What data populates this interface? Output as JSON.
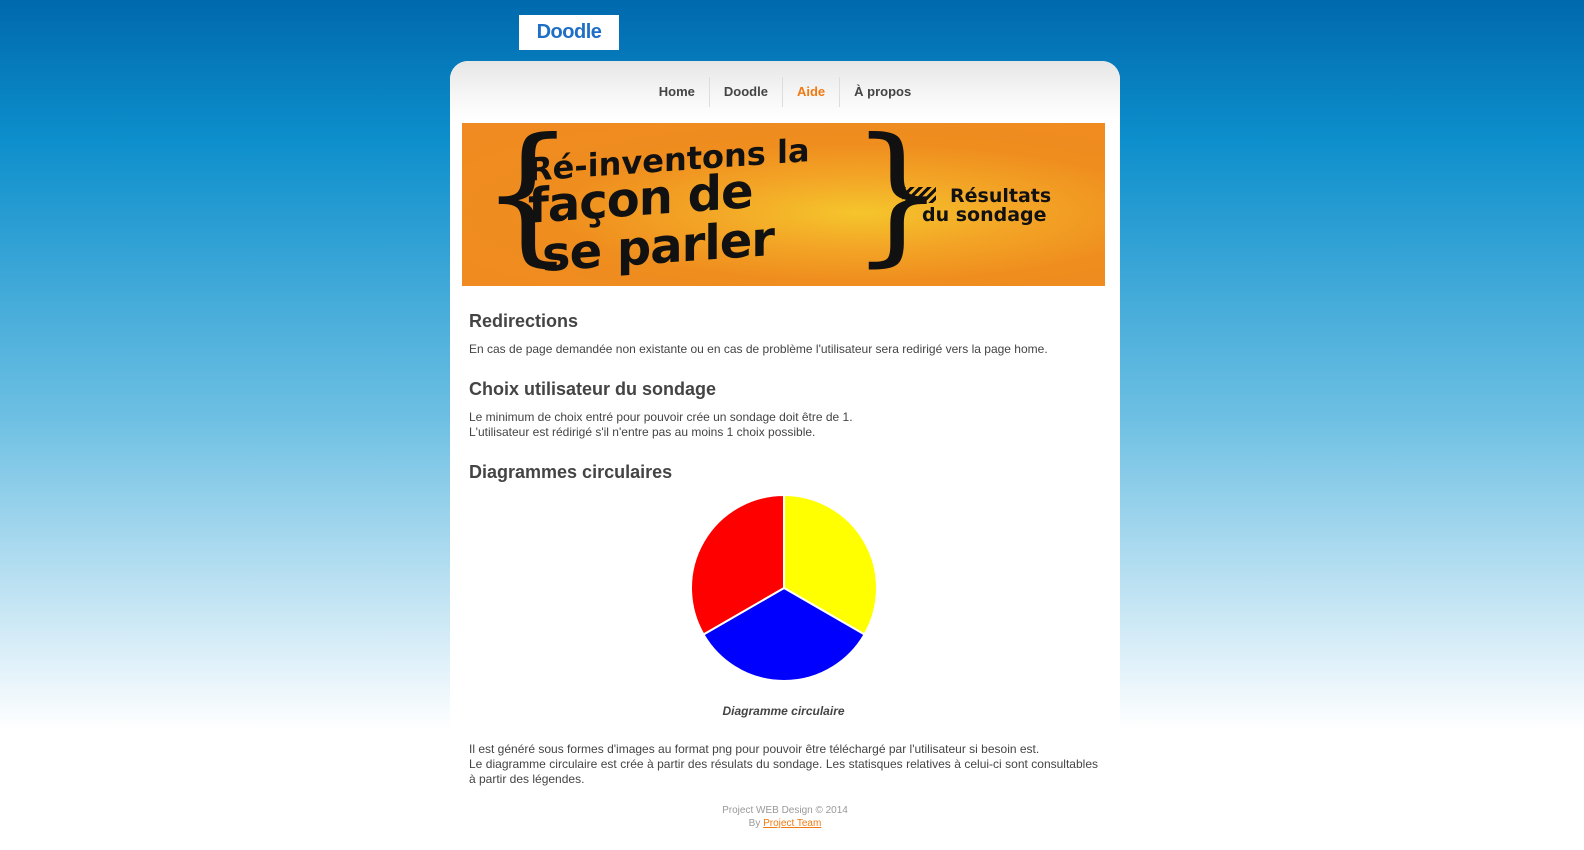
{
  "logo": {
    "text": "Doodle"
  },
  "nav": {
    "items": [
      {
        "label": "Home"
      },
      {
        "label": "Doodle"
      },
      {
        "label": "Aide"
      },
      {
        "label": "À propos"
      }
    ],
    "active": "Aide",
    "active_color": "#f07a10"
  },
  "banner": {
    "line1": "Ré-inventons la",
    "line2": "façon de",
    "line3": "se parler",
    "results_line1": "Résultats",
    "results_line2": "du sondage"
  },
  "sections": {
    "redirections": {
      "title": "Redirections",
      "text": "En cas de page demandée non existante ou en cas de problème l'utilisateur sera redirigé vers la page home."
    },
    "choix": {
      "title": "Choix utilisateur du sondage",
      "line1": "Le minimum de choix entré pour pouvoir crée un sondage doit être de 1.",
      "line2": "L'utilisateur est rédirigé s'il n'entre pas au moins 1 choix possible."
    },
    "diagrammes": {
      "title": "Diagrammes circulaires",
      "caption": "Diagramme circulaire",
      "line1": "Il est généré sous formes d'images au format png pour pouvoir être téléchargé par l'utilisateur si besoin est.",
      "line2": "Le diagramme circulaire est crée à partir des résulats du sondage. Les statisques relatives à celui-ci sont consultables à partir des légendes."
    }
  },
  "pie_chart": {
    "type": "pie",
    "slices": [
      {
        "value": 33.33,
        "color": "#ffff00"
      },
      {
        "value": 33.33,
        "color": "#0000ff"
      },
      {
        "value": 33.33,
        "color": "#ff0000"
      }
    ]
  },
  "footer": {
    "line1": "Project WEB Design © 2014",
    "by": "By",
    "link": "Project Team"
  }
}
